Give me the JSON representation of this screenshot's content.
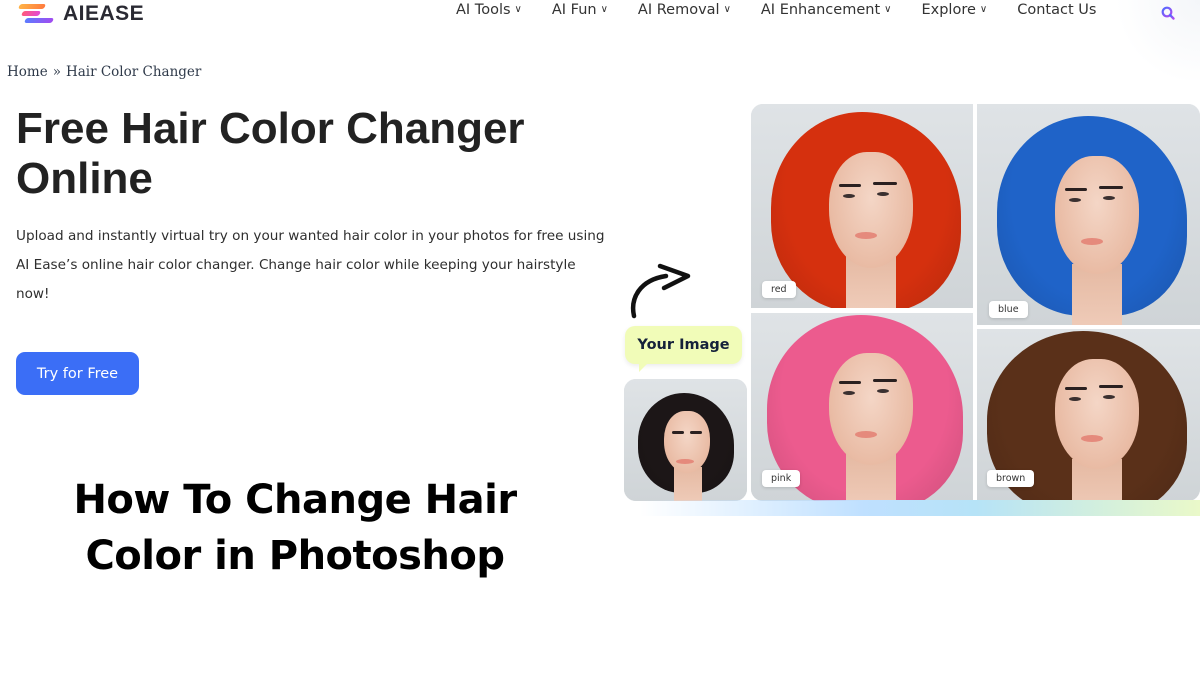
{
  "header": {
    "logo_text": "AIEASE",
    "nav": [
      {
        "label": "AI Tools",
        "has_dropdown": true
      },
      {
        "label": "AI Fun",
        "has_dropdown": true
      },
      {
        "label": "AI Removal",
        "has_dropdown": true
      },
      {
        "label": "AI Enhancement",
        "has_dropdown": true
      },
      {
        "label": "Explore",
        "has_dropdown": true
      },
      {
        "label": "Contact Us",
        "has_dropdown": false
      }
    ],
    "search_icon": "search-icon",
    "chevron": "⌄"
  },
  "breadcrumb": {
    "home": "Home",
    "separator": "»",
    "current": "Hair Color Changer"
  },
  "hero": {
    "title": "Free Hair Color Changer Online",
    "description": "Upload and instantly virtual try on your wanted hair color in your photos for free using AI Ease’s online hair color changer. Change hair color while keeping your hairstyle now!",
    "cta_label": "Try for Free"
  },
  "article_title": "How To Change Hair Color in Photoshop",
  "demo": {
    "your_image_label": "Your Image",
    "results": [
      {
        "label": "red",
        "hair_color": "#d5300e"
      },
      {
        "label": "blue",
        "hair_color": "#1f63c8"
      },
      {
        "label": "pink",
        "hair_color": "#ec5b8e"
      },
      {
        "label": "brown",
        "hair_color": "#5a3019"
      }
    ],
    "original_hair_color": "#1c1617"
  },
  "colors": {
    "accent": "#3b6ef6",
    "bubble": "#f1fcb8",
    "search_icon": "#7b4df0"
  }
}
